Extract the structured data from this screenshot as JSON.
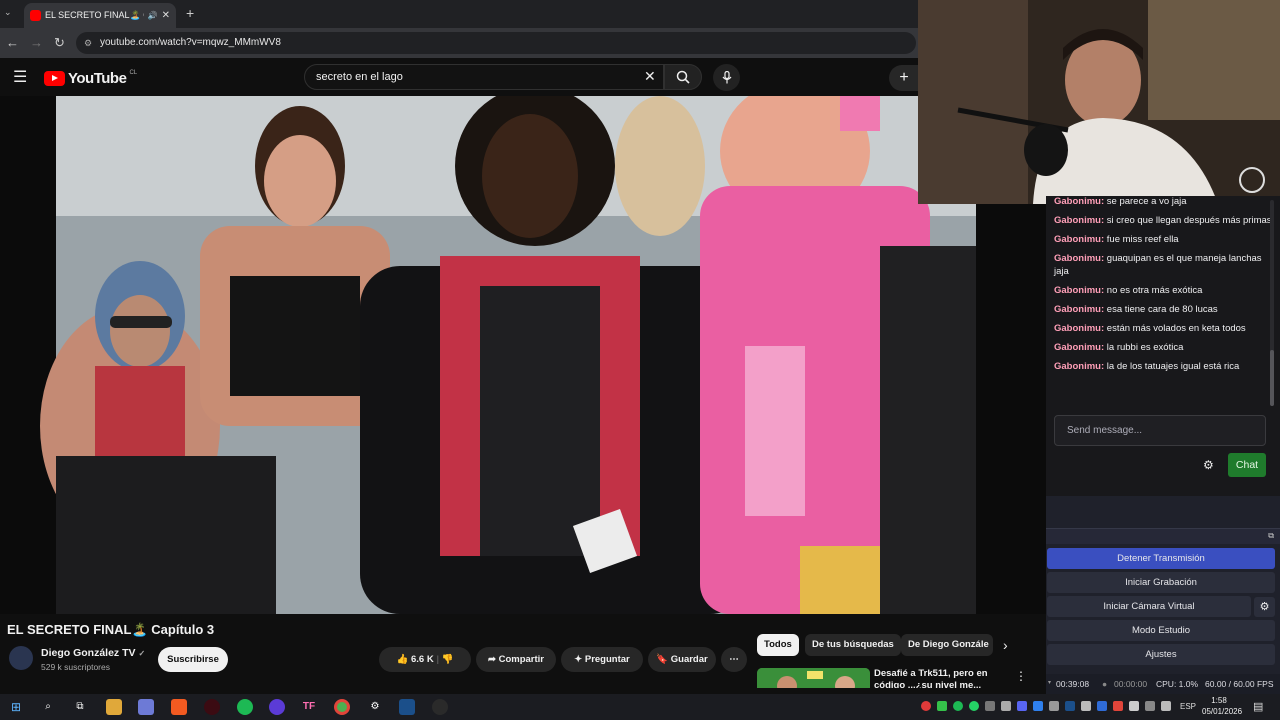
{
  "browser": {
    "tab_title": "EL SECRETO FINAL🏝️ Capítulo 3",
    "tab_close": "✕",
    "tab_down": "⌄",
    "new_tab": "+",
    "url": "youtube.com/watch?v=mqwz_MMmWV8",
    "back": "←",
    "forward": "→",
    "reload": "↻"
  },
  "youtube": {
    "logo_text": "YouTube",
    "logo_region": "CL",
    "search_value": "secreto en el lago",
    "video_title": "EL SECRETO FINAL🏝️ Capítulo 3",
    "channel_name": "Diego González TV",
    "verified": "✓",
    "subscribers": "529 k suscriptores",
    "subscribe_label": "Suscribirse",
    "likes": "6.6 K",
    "share_label": "Compartir",
    "ask_label": "Preguntar",
    "save_label": "Guardar",
    "more_label": "⋯",
    "chips": [
      "Todos",
      "De tus búsquedas",
      "De Diego Gonzále"
    ],
    "recommendation": {
      "title": "Desafié a Trk511, pero en código ...¿su nivel me..."
    }
  },
  "chat": {
    "messages": [
      {
        "user": "Gabonimu:",
        "text": "se parece a vo jaja"
      },
      {
        "user": "Gabonimu:",
        "text": "si creo que llegan después más primas"
      },
      {
        "user": "Gabonimu:",
        "text": "fue miss reef ella"
      },
      {
        "user": "Gabonimu:",
        "text": "guaquipan es el que maneja lanchas jaja"
      },
      {
        "user": "Gabonimu:",
        "text": "no es otra más exótica"
      },
      {
        "user": "Gabonimu:",
        "text": "esa tiene cara de 80 lucas"
      },
      {
        "user": "Gabonimu:",
        "text": "están más volados en keta todos"
      },
      {
        "user": "Gabonimu:",
        "text": "la rubbi es exótica"
      },
      {
        "user": "Gabonimu:",
        "text": "la de los tatuajes igual está rica"
      }
    ],
    "input_placeholder": "Send message...",
    "chat_button": "Chat"
  },
  "obs": {
    "stop_stream": "Detener Transmisión",
    "start_recording": "Iniciar Grabación",
    "start_virtual_cam": "Iniciar Cámara Virtual",
    "studio_mode": "Modo Estudio",
    "settings": "Ajustes",
    "stream_time": "00:39:08",
    "rec_time": "00:00:00",
    "cpu": "CPU: 1.0%",
    "fps": "60.00 / 60.00 FPS"
  },
  "taskbar": {
    "language": "ESP",
    "time": "1:58",
    "date": "05/01/2026"
  },
  "colors": {
    "youtube_red": "#ff0000",
    "chat_user": "#ff9fb8",
    "obs_primary": "#3a4fc0",
    "chat_button": "#1f7b2c"
  }
}
